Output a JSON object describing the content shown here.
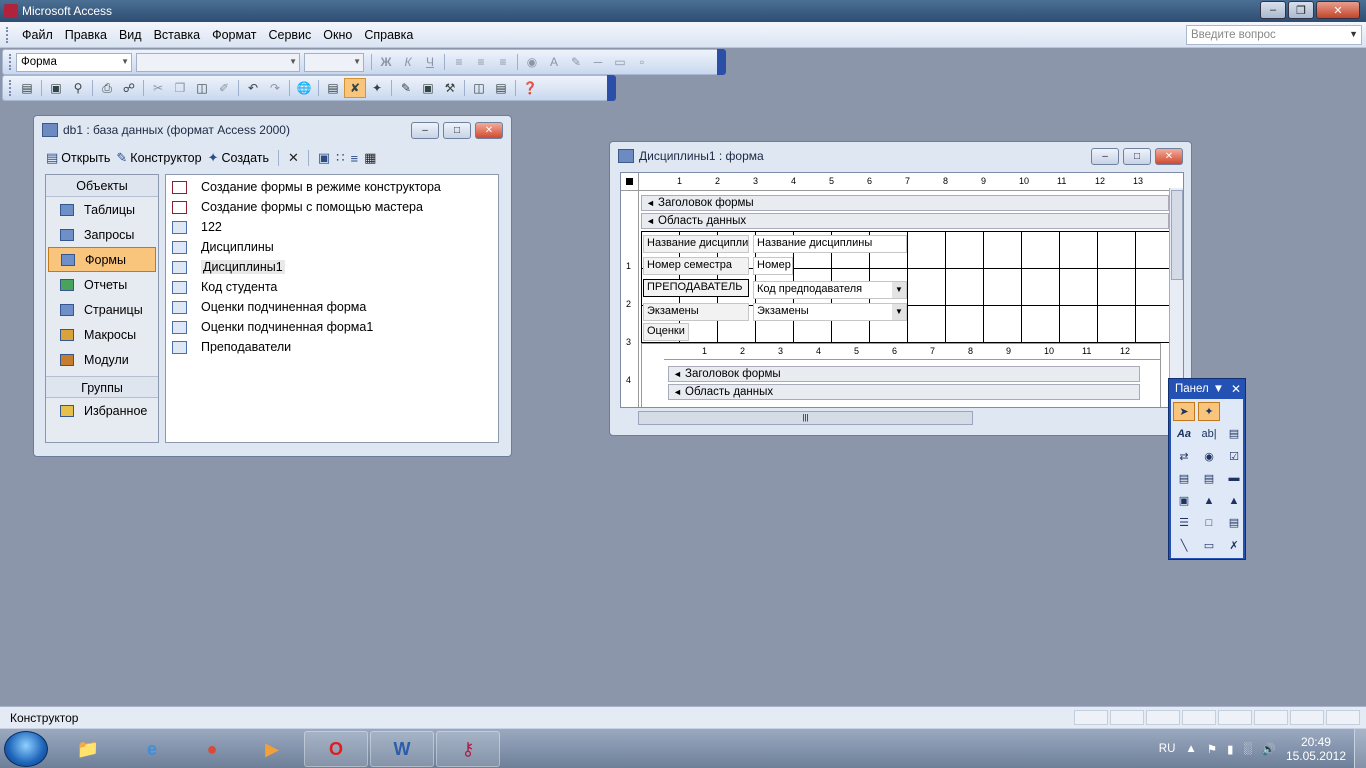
{
  "app": {
    "title": "Microsoft Access"
  },
  "menu": [
    {
      "label": "Файл",
      "key": "Ф"
    },
    {
      "label": "Правка",
      "key": "П"
    },
    {
      "label": "Вид",
      "key": "В"
    },
    {
      "label": "Вставка",
      "key": "с"
    },
    {
      "label": "Формат",
      "key": "о"
    },
    {
      "label": "Сервис",
      "key": "С"
    },
    {
      "label": "Окно",
      "key": "О"
    },
    {
      "label": "Справка",
      "key": "С"
    }
  ],
  "ask": {
    "placeholder": "Введите вопрос"
  },
  "format_toolbar": {
    "object_combo": "Форма",
    "font_combo": "",
    "size_combo": "",
    "bold": "Ж",
    "italic": "К",
    "underline": "Ч"
  },
  "db_window": {
    "title": "db1 : база данных (формат Access 2000)",
    "tools": {
      "open": "Открыть",
      "design": "Конструктор",
      "create": "Создать"
    },
    "objects_header": "Объекты",
    "objects": [
      "Таблицы",
      "Запросы",
      "Формы",
      "Отчеты",
      "Страницы",
      "Макросы",
      "Модули"
    ],
    "groups_header": "Группы",
    "favorites": "Избранное",
    "items": [
      "Создание формы в режиме конструктора",
      "Создание формы с помощью мастера",
      "122",
      "Дисциплины",
      "Дисциплины1",
      "Код студента",
      "Оценки подчиненная форма",
      "Оценки подчиненная форма1",
      "Преподаватели"
    ]
  },
  "form_window": {
    "title": "Дисциплины1 : форма",
    "section_header": "Заголовок формы",
    "section_detail": "Область данных",
    "ruler": [
      "1",
      "2",
      "3",
      "4",
      "5",
      "6",
      "7",
      "8",
      "9",
      "10",
      "11",
      "12",
      "13"
    ],
    "vruler": [
      "1",
      "2",
      "3",
      "4"
    ],
    "controls": {
      "lbl_name": "Название дисципли",
      "fld_name": "Название дисциплины",
      "lbl_sem": "Номер семестра",
      "fld_sem": "Номер",
      "lbl_teacher": "ПРЕПОДАВАТЕЛЬ",
      "fld_teacher": "Код предподавателя",
      "lbl_exams": "Экзамены",
      "fld_exams": "Экзамены",
      "lbl_grades": "Оценки"
    },
    "sub_ruler": [
      "1",
      "2",
      "3",
      "4",
      "5",
      "6",
      "7",
      "8",
      "9",
      "10",
      "11",
      "12"
    ]
  },
  "toolbox": {
    "title": "Панел"
  },
  "status": {
    "text": "Конструктор"
  },
  "tray": {
    "lang": "RU",
    "time": "20:49",
    "date": "15.05.2012"
  }
}
